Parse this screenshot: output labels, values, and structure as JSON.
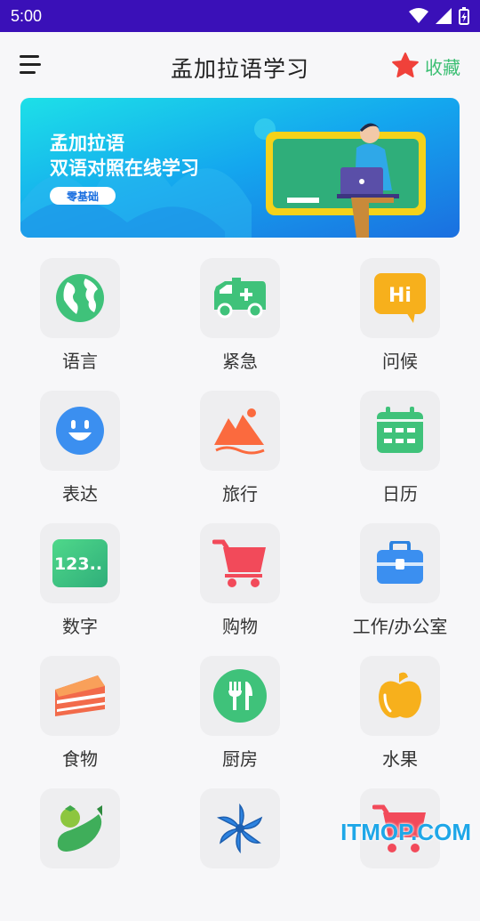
{
  "status": {
    "time": "5:00"
  },
  "header": {
    "title": "孟加拉语学习",
    "favorite_label": "收藏"
  },
  "banner": {
    "line1": "孟加拉语",
    "line2": "双语对照在线学习",
    "tag": "零基础"
  },
  "categories": [
    {
      "label": "语言",
      "icon": "globe-icon"
    },
    {
      "label": "紧急",
      "icon": "ambulance-icon"
    },
    {
      "label": "问候",
      "icon": "hi-bubble-icon"
    },
    {
      "label": "表达",
      "icon": "smiley-icon"
    },
    {
      "label": "旅行",
      "icon": "mountain-icon"
    },
    {
      "label": "日历",
      "icon": "calendar-icon"
    },
    {
      "label": "数字",
      "icon": "numbers-icon"
    },
    {
      "label": "购物",
      "icon": "cart-icon"
    },
    {
      "label": "工作/办公室",
      "icon": "briefcase-icon"
    },
    {
      "label": "食物",
      "icon": "cake-icon"
    },
    {
      "label": "厨房",
      "icon": "utensils-icon"
    },
    {
      "label": "水果",
      "icon": "apple-icon"
    },
    {
      "label": "",
      "icon": "vegetables-icon"
    },
    {
      "label": "",
      "icon": "star-anise-icon"
    },
    {
      "label": "",
      "icon": "cart-red-icon"
    }
  ],
  "watermark": "ITMOP.COM",
  "colors": {
    "statusbar": "#3a10b8",
    "accent_green": "#3dbf74",
    "star": "#f0413a"
  }
}
